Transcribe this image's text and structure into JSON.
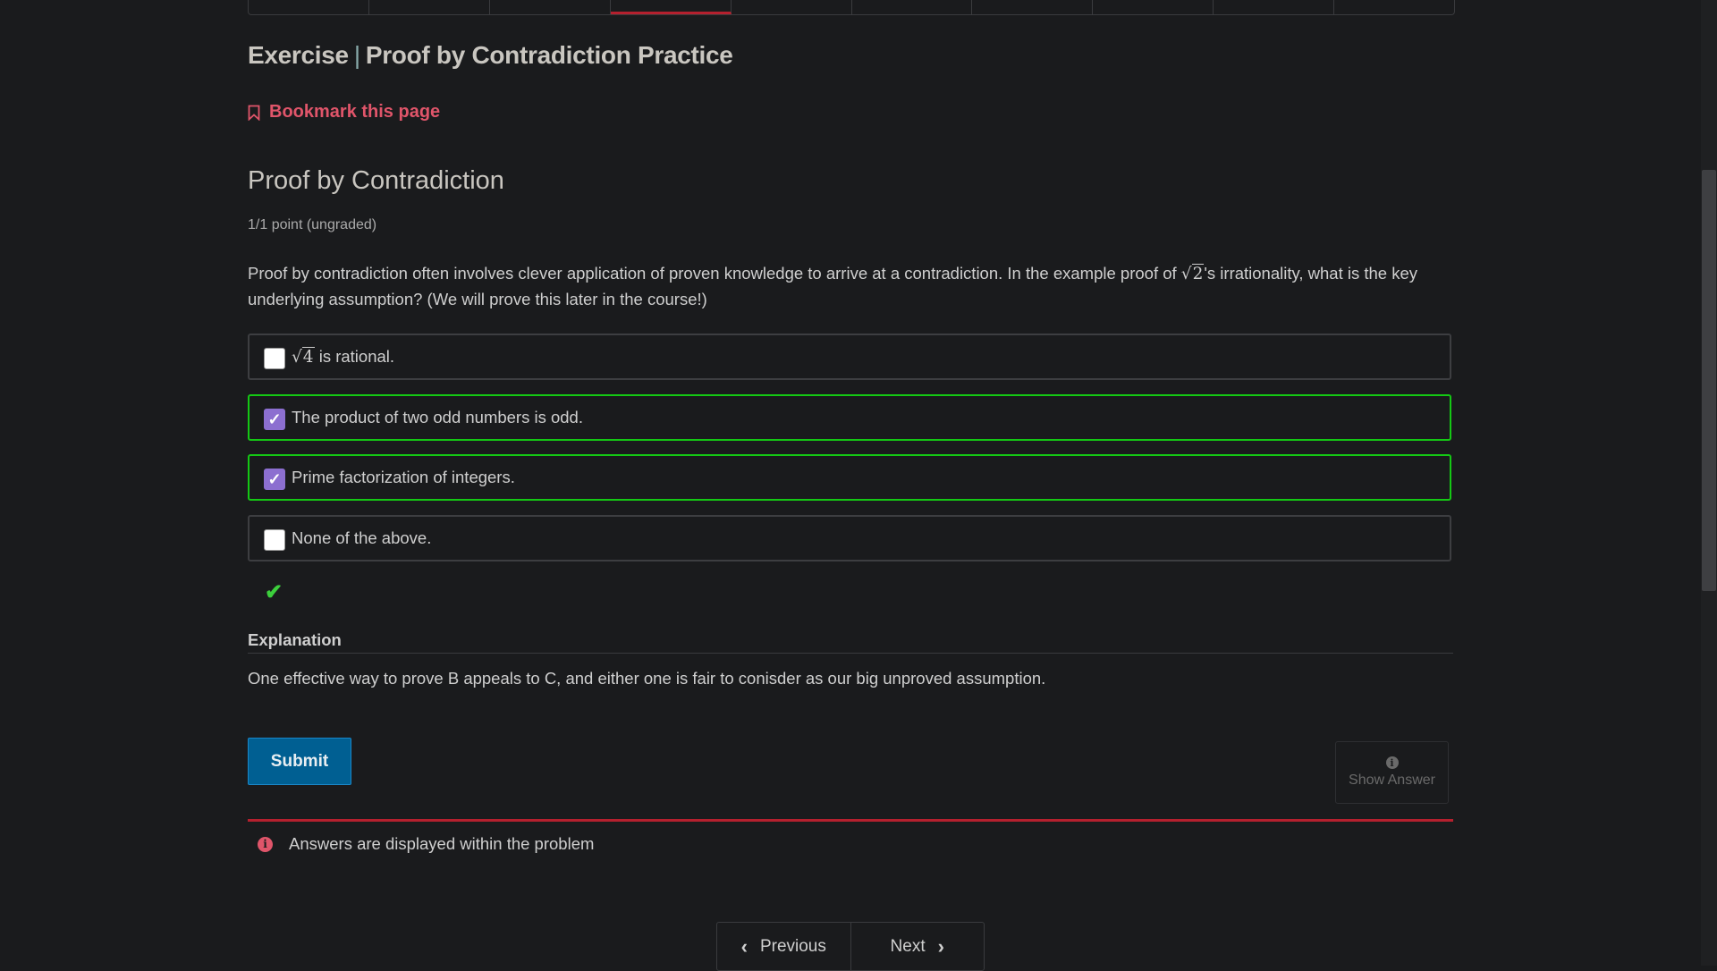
{
  "tabs": {
    "count": 10,
    "active_index": 3
  },
  "header": {
    "title_prefix": "Exercise",
    "title_separator": "|",
    "title_main": "Proof by Contradiction Practice",
    "bookmark_label": "Bookmark this page"
  },
  "problem": {
    "title": "Proof by Contradiction",
    "points": "1/1 point (ungraded)",
    "question_part1": "Proof by contradiction often involves clever application of proven knowledge to arrive at a contradiction. In the example proof of ",
    "question_math": "2",
    "question_part2": "'s irrationality, what is the key underlying assumption? (We will prove this later in the course!)",
    "options": [
      {
        "math": "4",
        "label": " is rational.",
        "checked": false,
        "correct": false
      },
      {
        "label": "The product of two odd numbers is odd.",
        "checked": true,
        "correct": true
      },
      {
        "label": "Prime factorization of integers.",
        "checked": true,
        "correct": true
      },
      {
        "label": "None of the above.",
        "checked": false,
        "correct": false
      }
    ],
    "status": "correct",
    "explanation_heading": "Explanation",
    "explanation_text": "One effective way to prove B appeals to C, and either one is fair to conisder as our big unproved assumption.",
    "submit_label": "Submit",
    "show_answer_label": "Show Answer",
    "notice": "Answers are displayed within the problem"
  },
  "pager": {
    "previous_label": "Previous",
    "next_label": "Next"
  },
  "colors": {
    "accent_red": "#b5202e",
    "bookmark": "#e0556a",
    "correct_border": "#14c814",
    "checkbox": "#8c6fd0",
    "submit": "#005f92"
  }
}
